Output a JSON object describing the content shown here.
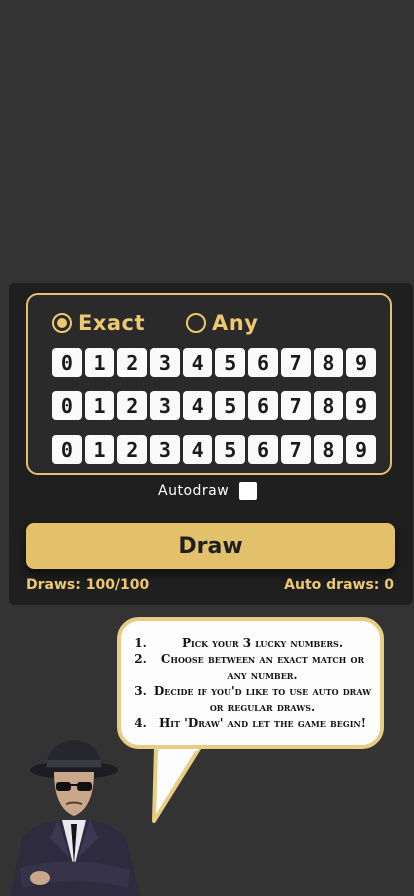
{
  "mode": {
    "exact_label": "Exact",
    "any_label": "Any",
    "selected": "Exact"
  },
  "digit_rows": [
    [
      "0",
      "1",
      "2",
      "3",
      "4",
      "5",
      "6",
      "7",
      "8",
      "9"
    ],
    [
      "0",
      "1",
      "2",
      "3",
      "4",
      "5",
      "6",
      "7",
      "8",
      "9"
    ],
    [
      "0",
      "1",
      "2",
      "3",
      "4",
      "5",
      "6",
      "7",
      "8",
      "9"
    ]
  ],
  "autodraw": {
    "label": "Autodraw",
    "checked": false
  },
  "draw_button": "Draw",
  "stats": {
    "draws": "Draws: 100/100",
    "auto_draws": "Auto draws: 0"
  },
  "instructions": [
    "Pick your 3 lucky numbers.",
    "Choose between an exact match or any number.",
    "Decide if you'd like to use auto draw or regular draws.",
    "Hit 'Draw' and let the game begin!"
  ],
  "colors": {
    "accent": "#e3c06a",
    "background": "#333333",
    "panel": "#1f1f1f"
  },
  "icons": {
    "mascot": "detective-character-icon"
  }
}
